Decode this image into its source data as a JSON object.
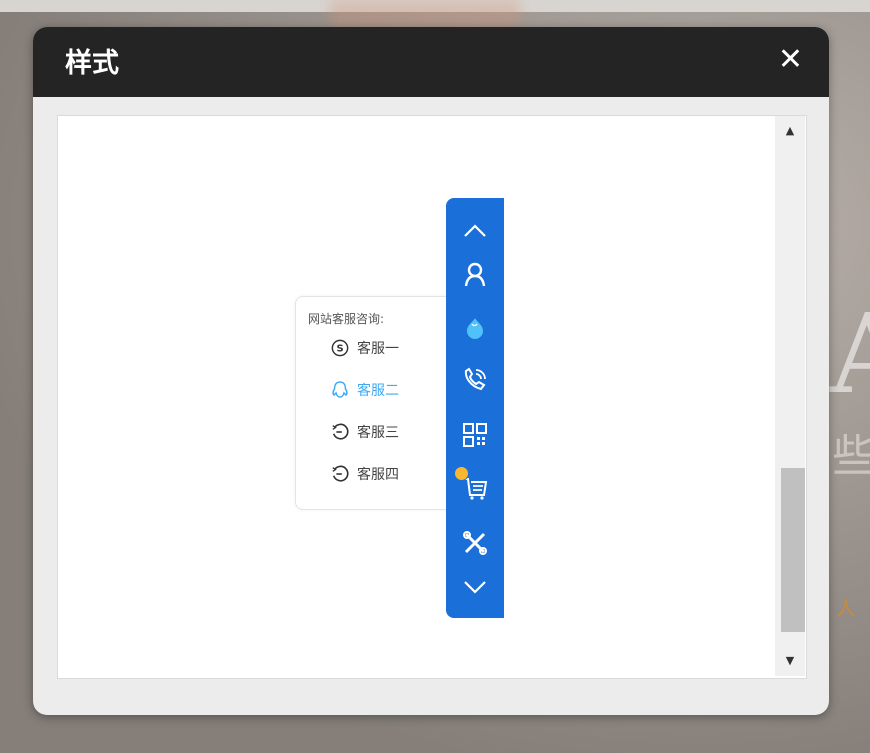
{
  "dialog": {
    "title": "样式",
    "close_symbol": "✕"
  },
  "scrollbar": {
    "up_symbol": "▲",
    "down_symbol": "▼",
    "thumb_position": 0.72
  },
  "preview": {
    "popup_title": "网站客服咨询:",
    "services": [
      {
        "label": "客服一",
        "icon": "skype-icon",
        "active": false
      },
      {
        "label": "客服二",
        "icon": "qq-icon",
        "active": true
      },
      {
        "label": "客服三",
        "icon": "clock-chat-icon",
        "active": false
      },
      {
        "label": "客服四",
        "icon": "clock-chat-icon",
        "active": false
      }
    ],
    "sidebar_icons": [
      "chevron-up-icon",
      "user-icon",
      "droplet-icon",
      "phone-icon",
      "qrcode-icon",
      "cart-icon",
      "tools-icon",
      "chevron-down-icon"
    ],
    "accent_color": "#1a6fd8",
    "active_color": "#3fa9f5"
  }
}
